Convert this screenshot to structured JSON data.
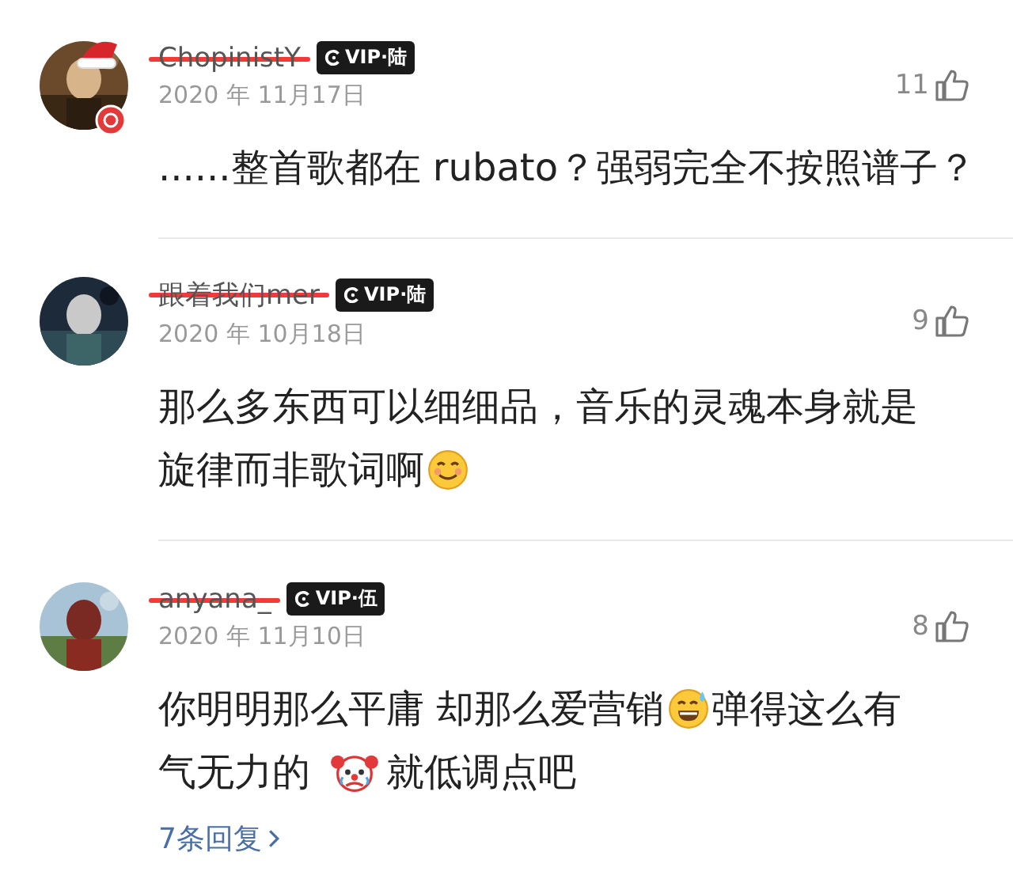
{
  "comments": [
    {
      "user": "ChopinistY",
      "badge": "VIP·陆",
      "date": "2020 年 11月17日",
      "likes": "11",
      "avatar": {
        "decorated": true
      },
      "lines": [
        [
          {
            "kind": "text",
            "text": "......整首歌都在 rubato？强弱完全不按照谱子？"
          }
        ]
      ]
    },
    {
      "user": "跟着我们mer",
      "badge": "VIP·陆",
      "date": "2020 年 10月18日",
      "likes": "9",
      "avatar": {
        "decorated": false
      },
      "lines": [
        [
          {
            "kind": "text",
            "text": "那么多东西可以细细品，音乐的灵魂本身就是"
          }
        ],
        [
          {
            "kind": "text",
            "text": "旋律而非歌词啊"
          },
          {
            "kind": "smile_emoji"
          }
        ]
      ]
    },
    {
      "user": "anyana_",
      "badge": "VIP·伍",
      "date": "2020 年 11月10日",
      "likes": "8",
      "avatar": {
        "decorated": false
      },
      "lines": [
        [
          {
            "kind": "text",
            "text": "你明明那么平庸 却那么爱营销"
          },
          {
            "kind": "sweat_emoji"
          },
          {
            "kind": "text",
            "text": "弹得这么有"
          }
        ],
        [
          {
            "kind": "text",
            "text": "气无力的"
          },
          {
            "kind": "clown_emoji"
          },
          {
            "kind": "text",
            "text": "就低调点吧"
          }
        ]
      ],
      "replies": "7条回复"
    }
  ]
}
